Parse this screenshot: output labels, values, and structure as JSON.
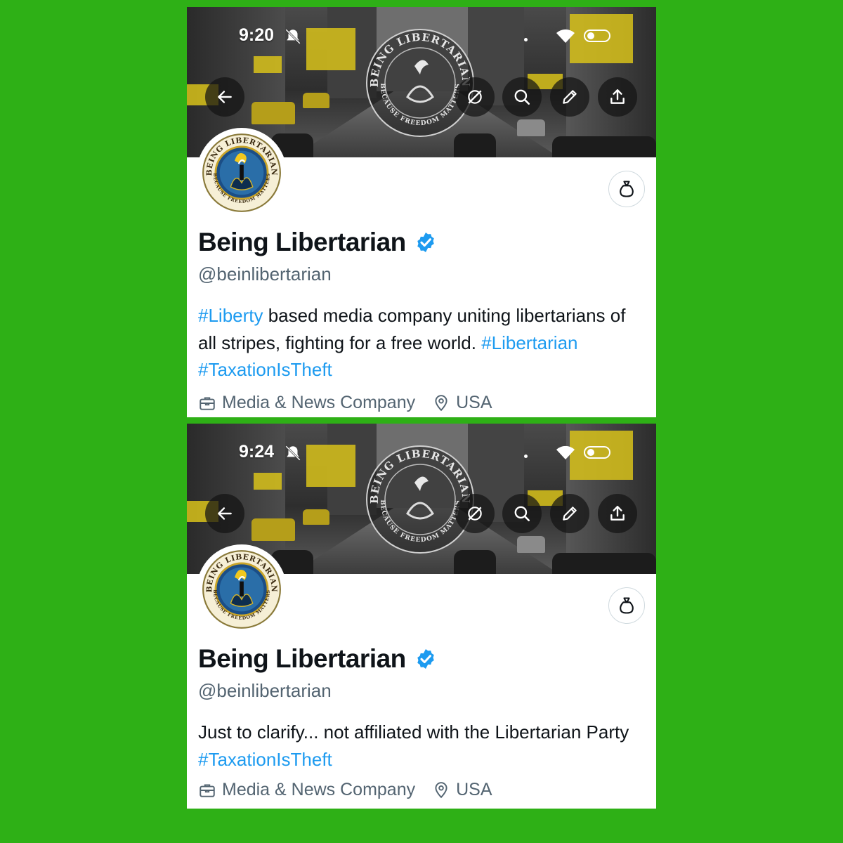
{
  "page": {
    "background": "#2eb016"
  },
  "profiles": [
    {
      "status": {
        "time": "9:20"
      },
      "display_name": "Being Libertarian",
      "handle": "@beinlibertarian",
      "bio": [
        {
          "text": "#Liberty",
          "hashtag": true
        },
        {
          "text": " based media company uniting libertarians of all stripes, fighting for a free world. ",
          "hashtag": false
        },
        {
          "text": "#Libertarian",
          "hashtag": true
        },
        {
          "text": " ",
          "hashtag": false
        },
        {
          "text": "#TaxationIsTheft",
          "hashtag": true
        }
      ],
      "category": "Media & News Company",
      "location": "USA"
    },
    {
      "status": {
        "time": "9:24"
      },
      "display_name": "Being Libertarian",
      "handle": "@beinlibertarian",
      "bio": [
        {
          "text": "Just to clarify... not affiliated with the Libertarian Party ",
          "hashtag": false
        },
        {
          "text": "#TaxationIsTheft",
          "hashtag": true
        }
      ],
      "category": "Media & News Company",
      "location": "USA"
    }
  ],
  "logo": {
    "top_text": "BEING LIBERTARIAN",
    "bottom_text": "BECAUSE FREEDOM MATTERS"
  },
  "icons": {
    "back": "arrow-left-icon",
    "grok": "grok-icon",
    "search": "search-icon",
    "edit": "pencil-icon",
    "share": "share-icon",
    "tip": "money-bag-icon",
    "verified": "verified-check-icon",
    "category": "briefcase-icon",
    "location": "location-pin-icon"
  },
  "colors": {
    "link": "#1d9bf0",
    "verified": "#1d9bf0",
    "text_primary": "#0f1419",
    "text_secondary": "#536471"
  }
}
